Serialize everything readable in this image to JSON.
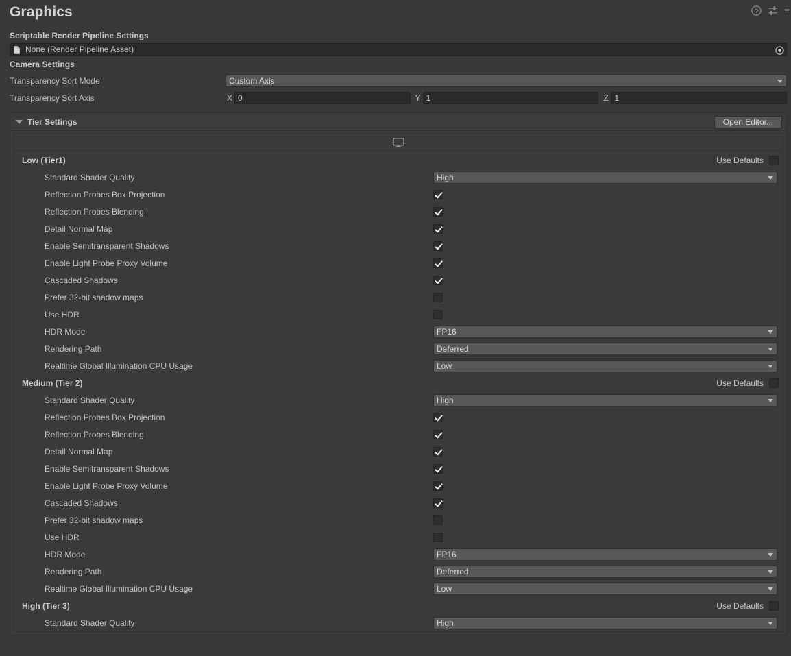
{
  "header": {
    "title": "Graphics",
    "icons": [
      {
        "name": "help-icon",
        "glyph": "?"
      },
      {
        "name": "preset-icon",
        "glyph": "preset"
      },
      {
        "name": "more-menu-icon",
        "glyph": "more"
      }
    ]
  },
  "srp": {
    "section_label": "Scriptable Render Pipeline Settings",
    "asset_value": "None (Render Pipeline Asset)",
    "file_icon": "file-icon",
    "picker_icon": "object-picker-icon"
  },
  "camera": {
    "section_label": "Camera Settings",
    "sort_mode": {
      "label": "Transparency Sort Mode",
      "value": "Custom Axis"
    },
    "sort_axis": {
      "label": "Transparency Sort Axis",
      "axes": [
        {
          "name": "X",
          "value": "0"
        },
        {
          "name": "Y",
          "value": "1"
        },
        {
          "name": "Z",
          "value": "1"
        }
      ]
    }
  },
  "tier_settings": {
    "title": "Tier Settings",
    "expanded": true,
    "open_editor_label": "Open Editor...",
    "platform_tab": "standalone-monitor-icon",
    "use_defaults_label": "Use Defaults",
    "tiers": [
      {
        "name": "Low (Tier1)",
        "use_defaults": false,
        "properties": [
          {
            "label": "Standard Shader Quality",
            "type": "dropdown",
            "value": "High"
          },
          {
            "label": "Reflection Probes Box Projection",
            "type": "checkbox",
            "value": true
          },
          {
            "label": "Reflection Probes Blending",
            "type": "checkbox",
            "value": true
          },
          {
            "label": "Detail Normal Map",
            "type": "checkbox",
            "value": true
          },
          {
            "label": "Enable Semitransparent Shadows",
            "type": "checkbox",
            "value": true
          },
          {
            "label": "Enable Light Probe Proxy Volume",
            "type": "checkbox",
            "value": true
          },
          {
            "label": "Cascaded Shadows",
            "type": "checkbox",
            "value": true
          },
          {
            "label": "Prefer 32-bit shadow maps",
            "type": "checkbox",
            "value": false
          },
          {
            "label": "Use HDR",
            "type": "checkbox",
            "value": false
          },
          {
            "label": "HDR Mode",
            "type": "dropdown",
            "value": "FP16"
          },
          {
            "label": "Rendering Path",
            "type": "dropdown",
            "value": "Deferred"
          },
          {
            "label": "Realtime Global Illumination CPU Usage",
            "type": "dropdown",
            "value": "Low"
          }
        ]
      },
      {
        "name": "Medium (Tier 2)",
        "use_defaults": false,
        "properties": [
          {
            "label": "Standard Shader Quality",
            "type": "dropdown",
            "value": "High"
          },
          {
            "label": "Reflection Probes Box Projection",
            "type": "checkbox",
            "value": true
          },
          {
            "label": "Reflection Probes Blending",
            "type": "checkbox",
            "value": true
          },
          {
            "label": "Detail Normal Map",
            "type": "checkbox",
            "value": true
          },
          {
            "label": "Enable Semitransparent Shadows",
            "type": "checkbox",
            "value": true
          },
          {
            "label": "Enable Light Probe Proxy Volume",
            "type": "checkbox",
            "value": true
          },
          {
            "label": "Cascaded Shadows",
            "type": "checkbox",
            "value": true
          },
          {
            "label": "Prefer 32-bit shadow maps",
            "type": "checkbox",
            "value": false
          },
          {
            "label": "Use HDR",
            "type": "checkbox",
            "value": false
          },
          {
            "label": "HDR Mode",
            "type": "dropdown",
            "value": "FP16"
          },
          {
            "label": "Rendering Path",
            "type": "dropdown",
            "value": "Deferred"
          },
          {
            "label": "Realtime Global Illumination CPU Usage",
            "type": "dropdown",
            "value": "Low"
          }
        ]
      },
      {
        "name": "High (Tier 3)",
        "use_defaults": false,
        "properties": [
          {
            "label": "Standard Shader Quality",
            "type": "dropdown",
            "value": "High"
          }
        ]
      }
    ]
  }
}
